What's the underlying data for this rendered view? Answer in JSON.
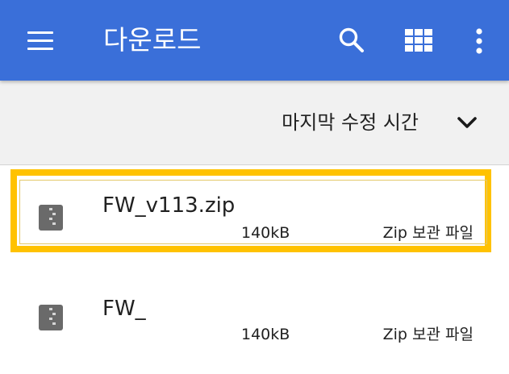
{
  "app_bar": {
    "title": "다운로드",
    "icons": [
      "menu-icon",
      "search-icon",
      "grid-view-icon",
      "more-vert-icon"
    ],
    "background_color": "#3a6fd9"
  },
  "sort": {
    "label": "마지막 수정 시간",
    "icon": "chevron-down-icon"
  },
  "files": [
    {
      "name": "FW_v113.zip",
      "size": "140kB",
      "type": "Zip 보관 파일",
      "icon": "zip-file-icon",
      "highlighted": true
    },
    {
      "name": "FW_",
      "size": "140kB",
      "type": "Zip 보관 파일",
      "icon": "zip-file-icon",
      "highlighted": false
    }
  ],
  "highlight_color": "#ffc200"
}
